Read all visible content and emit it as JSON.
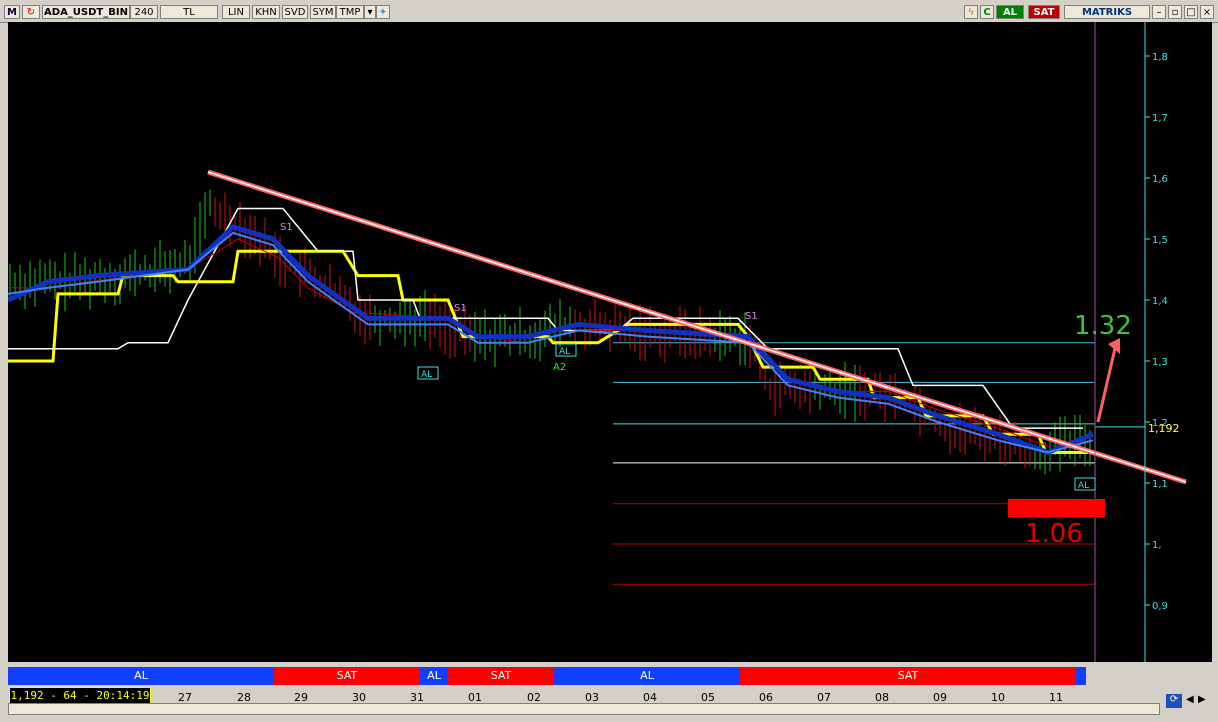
{
  "toolbar": {
    "logo": "M",
    "symbol": "ADA_USDT_BIN",
    "period": "240",
    "currency": "TL",
    "buttons": [
      "LIN",
      "KHN",
      "SVD",
      "SYM",
      "TMP"
    ],
    "al": "AL",
    "sat": "SAT",
    "brand": "MATRIKS",
    "c_label": "C"
  },
  "chart": {
    "y_ticks": [
      "1,8",
      "1,7",
      "1,6",
      "1,5",
      "1,4",
      "1,3",
      "1,2",
      "1,1",
      "1,",
      "0,9"
    ],
    "y_values": [
      1.8,
      1.7,
      1.6,
      1.5,
      1.4,
      1.3,
      1.2,
      1.1,
      1.0,
      0.9
    ],
    "current_price": "1,192",
    "target_up": "1.32",
    "target_down": "1.06",
    "signal_labels": [
      "S1",
      "S1",
      "S1",
      "A2"
    ],
    "al_box": "AL",
    "colors": {
      "up": "#00c000",
      "down": "#e00000",
      "yellow": "#ffff00",
      "blue": "#2060ff",
      "cyan": "#40e0e0"
    }
  },
  "signal_strip": [
    {
      "label": "AL",
      "type": "buy"
    },
    {
      "label": "SAT",
      "type": "sell"
    },
    {
      "label": "AL",
      "type": "buy"
    },
    {
      "label": "SAT",
      "type": "sell"
    },
    {
      "label": "AL",
      "type": "buy"
    },
    {
      "label": "SAT",
      "type": "sell"
    }
  ],
  "x_axis": [
    "27",
    "28",
    "29",
    "30",
    "31",
    "01",
    "02",
    "03",
    "04",
    "05",
    "06",
    "07",
    "08",
    "09",
    "10",
    "11"
  ],
  "status": "1,192 - 64 - 20:14:19"
}
